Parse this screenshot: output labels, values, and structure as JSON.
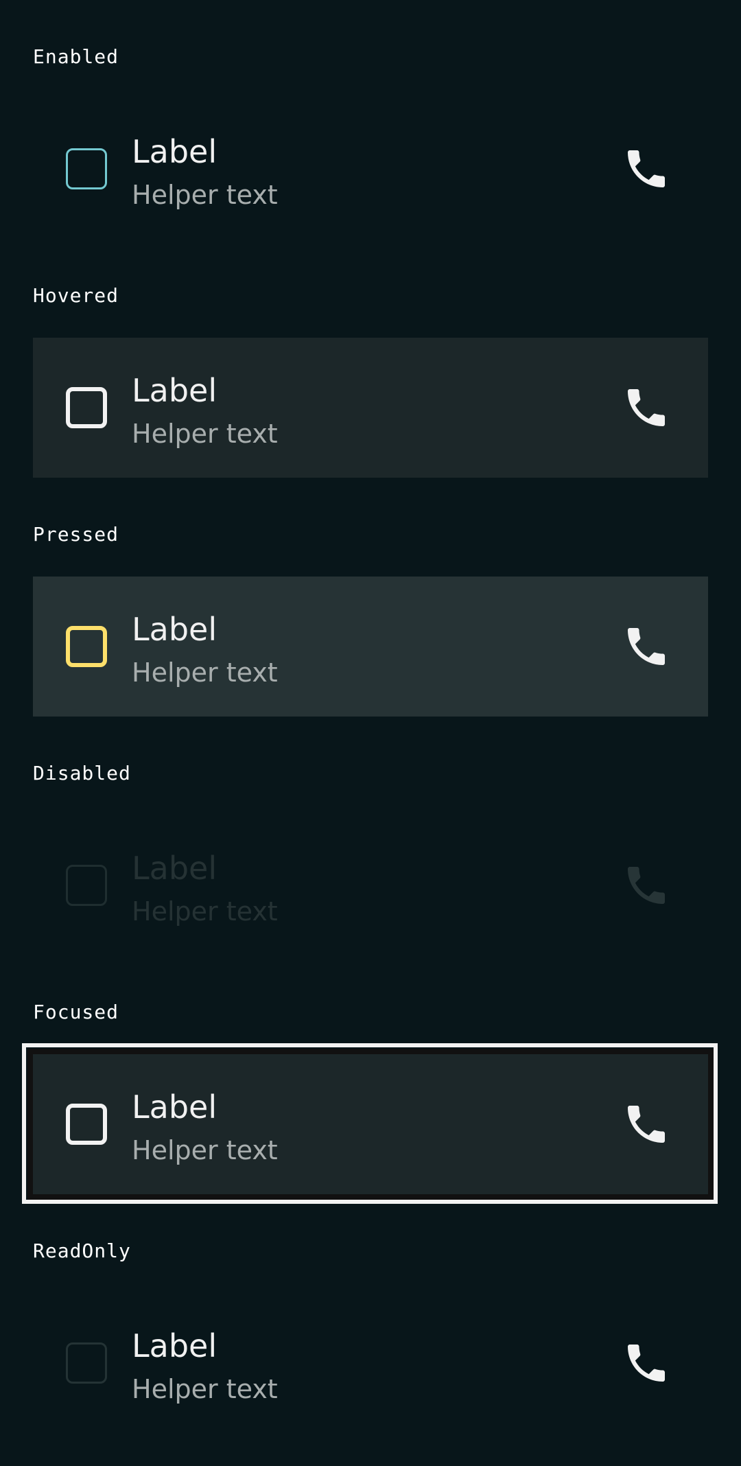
{
  "states": [
    {
      "title": "Enabled",
      "label": "Label",
      "helper": "Helper text"
    },
    {
      "title": "Hovered",
      "label": "Label",
      "helper": "Helper text"
    },
    {
      "title": "Pressed",
      "label": "Label",
      "helper": "Helper text"
    },
    {
      "title": "Disabled",
      "label": "Label",
      "helper": "Helper text"
    },
    {
      "title": "Focused",
      "label": "Label",
      "helper": "Helper text"
    },
    {
      "title": "ReadOnly",
      "label": "Label",
      "helper": "Helper text"
    }
  ],
  "icons": {
    "trailing": "phone-icon"
  },
  "colors": {
    "background": "#08161a",
    "title": "#ffffff",
    "label": "#f1f1f1",
    "helper": "#a8aeae",
    "enabled_checkbox": "#74c9d1",
    "pressed_checkbox": "#fde06b",
    "disabled_content": "#253234",
    "focus_ring": "#f3f3f3"
  }
}
